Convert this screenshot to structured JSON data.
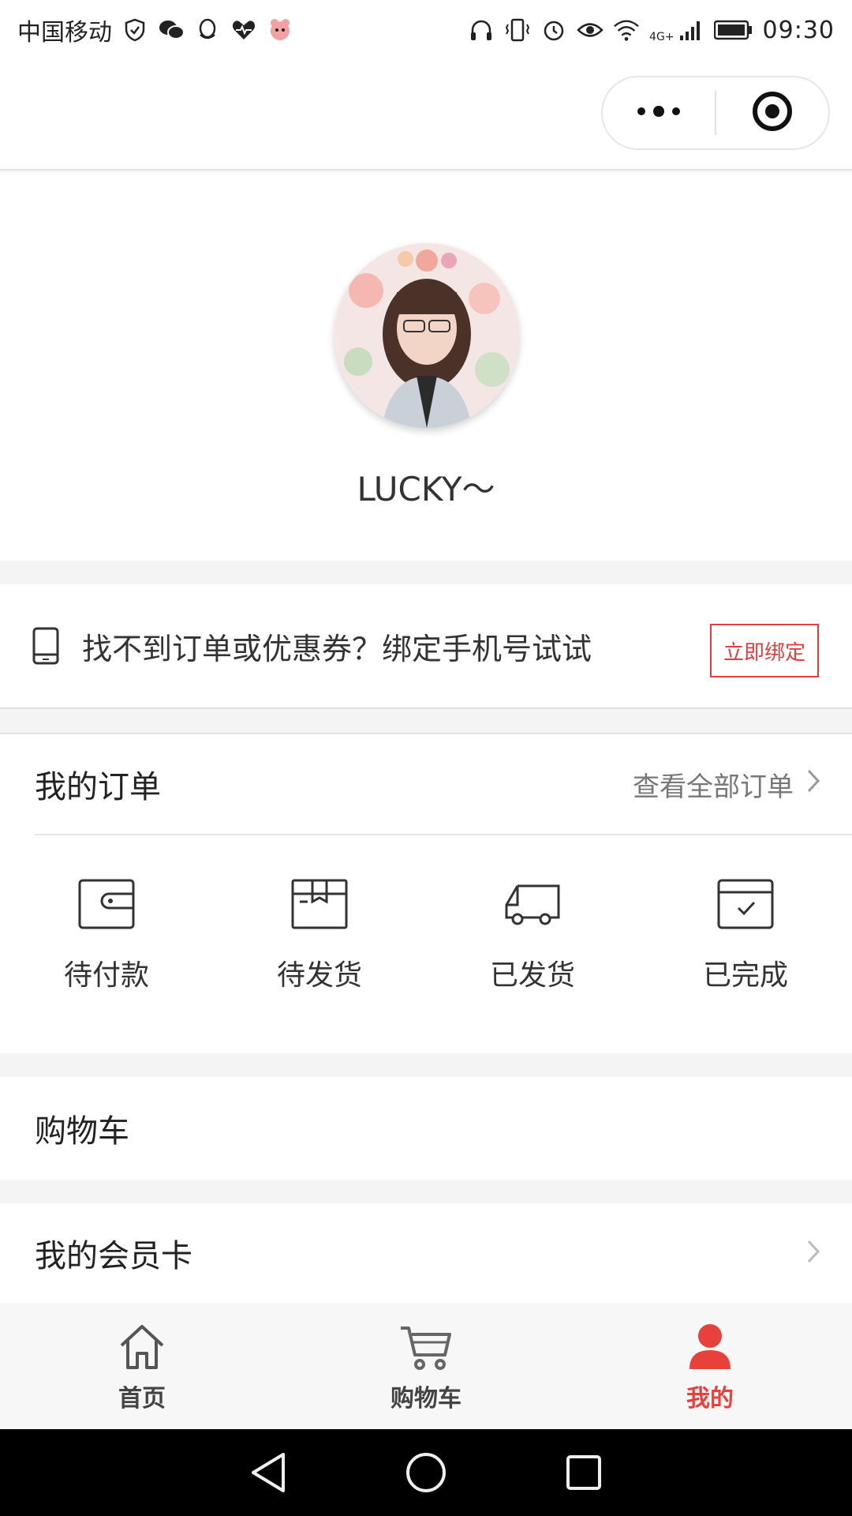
{
  "status_bar": {
    "carrier": "中国移动",
    "network": "4G+",
    "time": "09:30"
  },
  "title_bar": {
    "more_icon": "more-dots-icon",
    "close_icon": "target-icon"
  },
  "profile": {
    "username": "LUCKY～"
  },
  "bind_bar": {
    "text": "找不到订单或优惠券？绑定手机号试试",
    "button_label": "立即绑定",
    "accent": "#e33d3d"
  },
  "orders": {
    "title": "我的订单",
    "view_all": "查看全部订单",
    "statuses": [
      {
        "label": "待付款",
        "icon": "wallet-icon"
      },
      {
        "label": "待发货",
        "icon": "box-icon"
      },
      {
        "label": "已发货",
        "icon": "truck-icon"
      },
      {
        "label": "已完成",
        "icon": "check-box-icon"
      }
    ]
  },
  "cart_row": {
    "label": "购物车"
  },
  "member_row": {
    "label": "我的会员卡"
  },
  "tab_bar": {
    "items": [
      {
        "label": "首页",
        "icon": "home-icon"
      },
      {
        "label": "购物车",
        "icon": "cart-icon"
      },
      {
        "label": "我的",
        "icon": "user-icon",
        "active": true
      }
    ],
    "active_color": "#e8413c"
  }
}
